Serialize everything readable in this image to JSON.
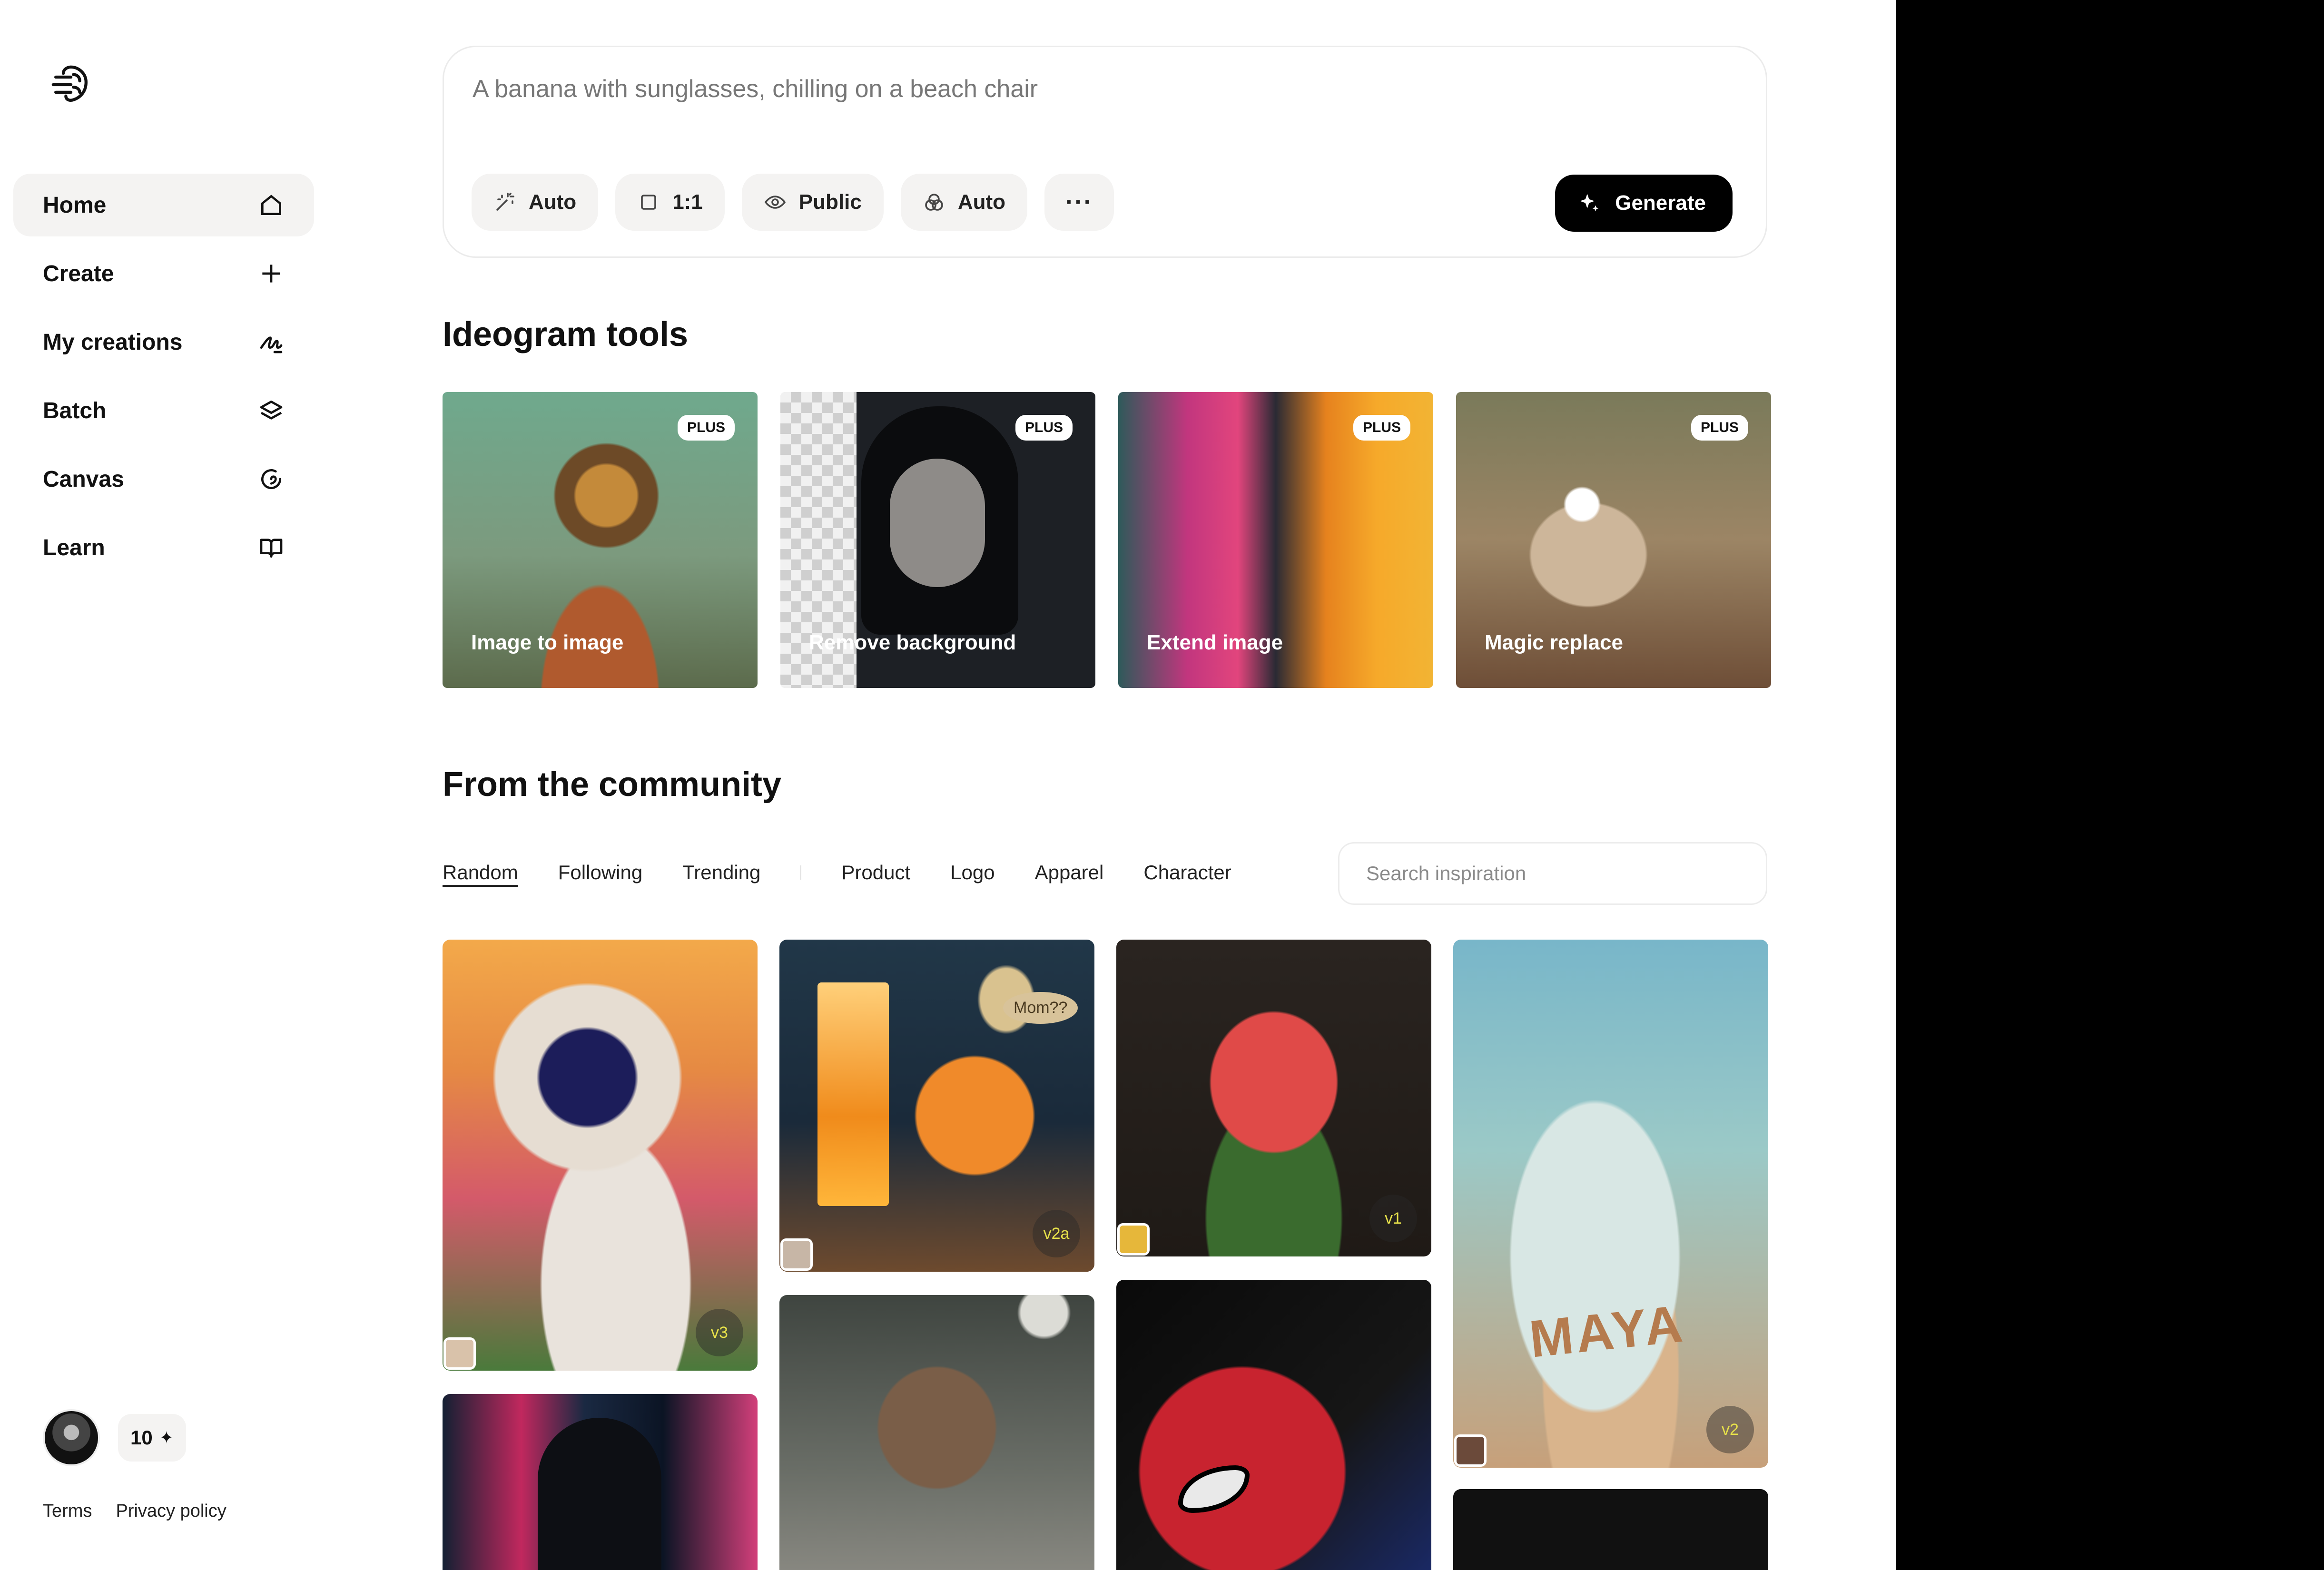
{
  "sidebar": {
    "logo_icon": "brain-icon",
    "items": [
      {
        "label": "Home",
        "icon": "home-icon",
        "active": true
      },
      {
        "label": "Create",
        "icon": "plus-icon"
      },
      {
        "label": "My creations",
        "icon": "signature-icon"
      },
      {
        "label": "Batch",
        "icon": "layers-icon"
      },
      {
        "label": "Canvas",
        "icon": "canvas-icon"
      },
      {
        "label": "Learn",
        "icon": "book-icon"
      }
    ],
    "credits": "10",
    "credits_icon": "sparkle-icon",
    "footer": {
      "terms": "Terms",
      "privacy": "Privacy policy"
    }
  },
  "prompt": {
    "placeholder": "A banana with sunglasses, chilling on a beach chair",
    "chips": [
      {
        "label": "Auto",
        "icon": "magic-wand-icon"
      },
      {
        "label": "1:1",
        "icon": "square-icon"
      },
      {
        "label": "Public",
        "icon": "eye-icon"
      },
      {
        "label": "Auto",
        "icon": "palette-icon"
      },
      {
        "label": "···",
        "icon": "more-icon"
      }
    ],
    "generate_label": "Generate"
  },
  "tools": {
    "heading": "Ideogram tools",
    "badge": "PLUS",
    "items": [
      {
        "label": "Image to image"
      },
      {
        "label": "Remove background"
      },
      {
        "label": "Extend image"
      },
      {
        "label": "Magic replace"
      }
    ]
  },
  "community": {
    "heading": "From the community",
    "tabs": [
      "Random",
      "Following",
      "Trending",
      "Product",
      "Logo",
      "Apparel",
      "Character"
    ],
    "active_tab": "Random",
    "search_placeholder": "Search inspiration",
    "images": [
      {
        "version": "v3"
      },
      {
        "version": "v2a",
        "bubble": "Mom??"
      },
      {
        "version": "v1"
      },
      {
        "version": "v2",
        "sand_text": "MAYA"
      }
    ]
  },
  "colors": {
    "accent": "#000000",
    "chip_bg": "#f4f3f2",
    "badge_text": "#e6e04a"
  }
}
